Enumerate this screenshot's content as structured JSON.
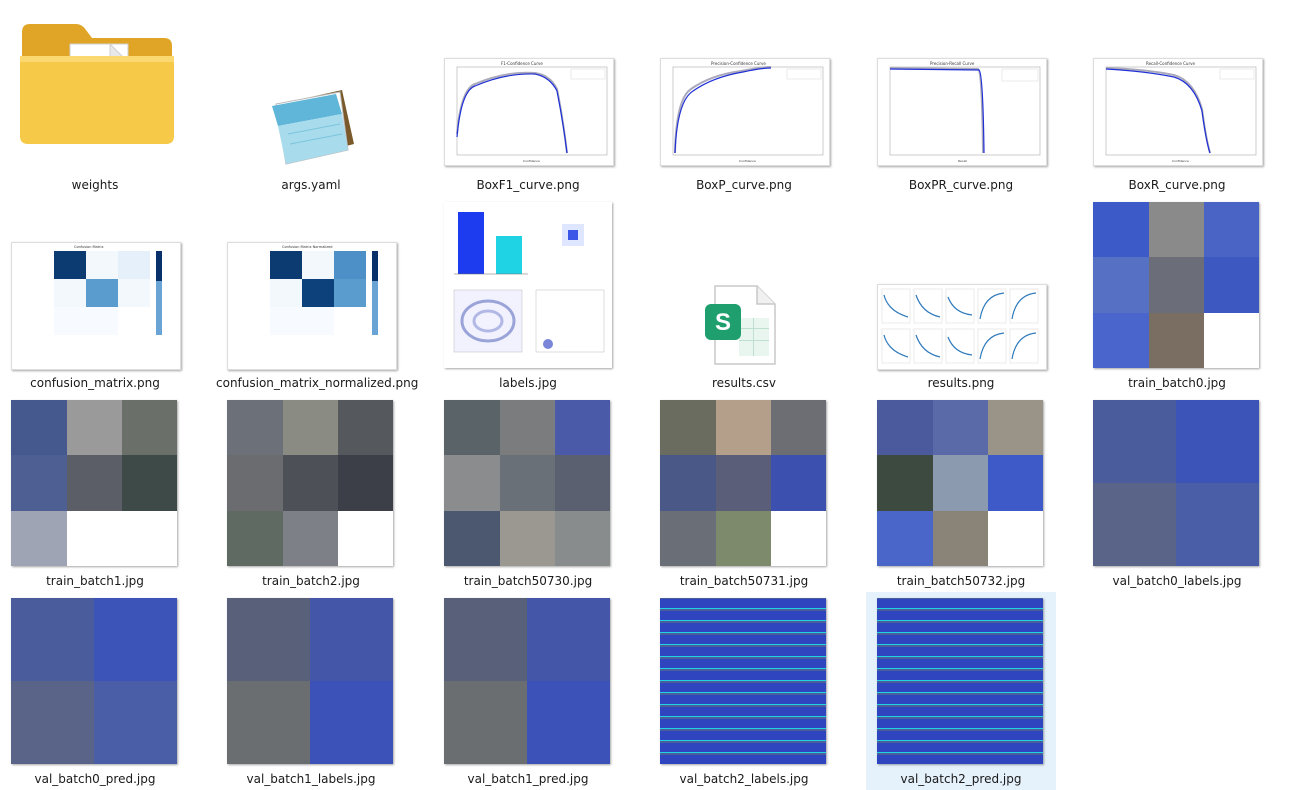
{
  "files": [
    {
      "name": "weights",
      "type": "folder"
    },
    {
      "name": "args.yaml",
      "type": "yaml"
    },
    {
      "name": "BoxF1_curve.png",
      "type": "curve",
      "chart_title": "F1-Confidence Curve",
      "xlabel": "Confidence",
      "ylabel": "F1"
    },
    {
      "name": "BoxP_curve.png",
      "type": "curve",
      "chart_title": "Precision-Confidence Curve",
      "xlabel": "Confidence",
      "ylabel": "Precision"
    },
    {
      "name": "BoxPR_curve.png",
      "type": "curve",
      "chart_title": "Precision-Recall Curve",
      "xlabel": "Recall",
      "ylabel": "Precision"
    },
    {
      "name": "BoxR_curve.png",
      "type": "curve",
      "chart_title": "Recall-Confidence Curve",
      "xlabel": "Confidence",
      "ylabel": "Recall"
    },
    {
      "name": "confusion_matrix.png",
      "type": "matrix",
      "chart_title": "Confusion Matrix"
    },
    {
      "name": "confusion_matrix_normalized.png",
      "type": "matrix",
      "chart_title": "Confusion Matrix Normalized"
    },
    {
      "name": "labels.jpg",
      "type": "labels"
    },
    {
      "name": "results.csv",
      "type": "csv",
      "icon_letter": "S"
    },
    {
      "name": "results.png",
      "type": "results"
    },
    {
      "name": "train_batch0.jpg",
      "type": "mosaic"
    },
    {
      "name": "train_batch1.jpg",
      "type": "mosaic"
    },
    {
      "name": "train_batch2.jpg",
      "type": "mosaic"
    },
    {
      "name": "train_batch50730.jpg",
      "type": "mosaic"
    },
    {
      "name": "train_batch50731.jpg",
      "type": "mosaic"
    },
    {
      "name": "train_batch50732.jpg",
      "type": "mosaic"
    },
    {
      "name": "val_batch0_labels.jpg",
      "type": "mosaic"
    },
    {
      "name": "val_batch0_pred.jpg",
      "type": "mosaic"
    },
    {
      "name": "val_batch1_labels.jpg",
      "type": "mosaic"
    },
    {
      "name": "val_batch1_pred.jpg",
      "type": "mosaic"
    },
    {
      "name": "val_batch2_labels.jpg",
      "type": "mosaic"
    },
    {
      "name": "val_batch2_pred.jpg",
      "type": "mosaic",
      "selected": true
    }
  ],
  "colors": {
    "selection": "#e5f1fb",
    "folder": "#f7c948",
    "csv_green": "#1f9e6e",
    "curve_blue": "#1f2fd6"
  }
}
